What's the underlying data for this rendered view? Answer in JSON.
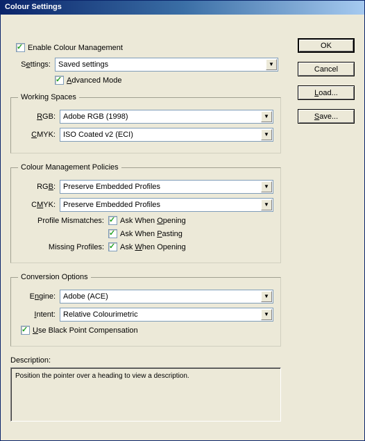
{
  "title": "Colour Settings",
  "buttons": {
    "ok": "OK",
    "cancel": "Cancel",
    "load": "Load...",
    "save": "Save..."
  },
  "enable": {
    "label": "Enable Colour Management",
    "checked": true
  },
  "settings": {
    "label": "Settings:",
    "value": "Saved settings",
    "advanced": {
      "label": "Advanced Mode",
      "checked": true
    }
  },
  "workingSpaces": {
    "legend": "Working Spaces",
    "rgbLabel": "RGB:",
    "rgbValue": "Adobe RGB (1998)",
    "cmykLabel": "CMYK:",
    "cmykValue": "ISO Coated v2 (ECI)"
  },
  "policies": {
    "legend": "Colour Management Policies",
    "rgbLabel": "RGB:",
    "rgbValue": "Preserve Embedded Profiles",
    "cmykLabel": "CMYK:",
    "cmykValue": "Preserve Embedded Profiles",
    "mismatchLabel": "Profile Mismatches:",
    "mismatchOpen": {
      "label": "Ask When Opening",
      "checked": true
    },
    "mismatchPaste": {
      "label": "Ask When Pasting",
      "checked": true
    },
    "missingLabel": "Missing Profiles:",
    "missingOpen": {
      "label": "Ask When Opening",
      "checked": true
    }
  },
  "conversion": {
    "legend": "Conversion Options",
    "engineLabel": "Engine:",
    "engineValue": "Adobe (ACE)",
    "intentLabel": "Intent:",
    "intentValue": "Relative Colourimetric",
    "blackPoint": {
      "label": "Use Black Point Compensation",
      "checked": true
    }
  },
  "description": {
    "label": "Description:",
    "text": "Position the pointer over a heading to view a description."
  }
}
